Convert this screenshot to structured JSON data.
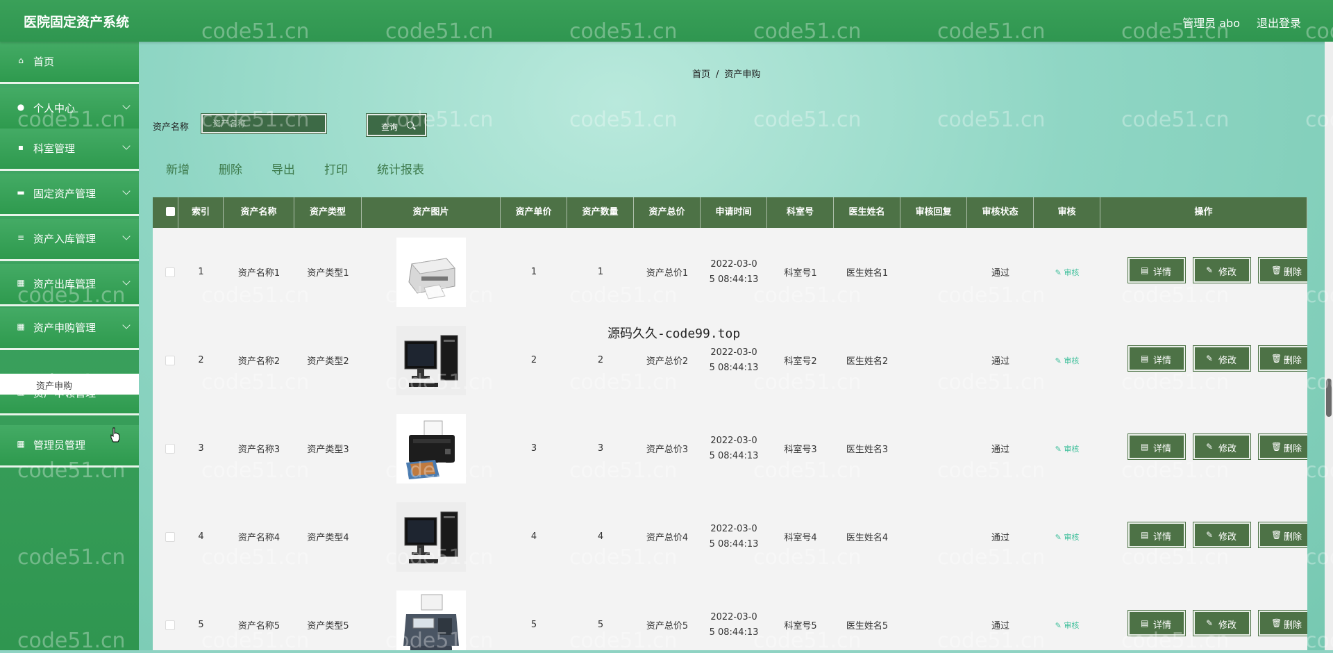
{
  "header": {
    "title": "医院固定资产系统",
    "user": "管理员 abo",
    "logout": "退出登录"
  },
  "sidebar": {
    "items": [
      {
        "label": "首页",
        "icon": "home-icon",
        "arrow": false
      },
      {
        "label": "个人中心",
        "icon": "user-icon",
        "arrow": true
      },
      {
        "label": "科室管理",
        "icon": "clipboard-icon",
        "arrow": true
      },
      {
        "label": "固定资产管理",
        "icon": "file-icon",
        "arrow": true
      },
      {
        "label": "资产入库管理",
        "icon": "list-icon",
        "arrow": true
      },
      {
        "label": "资产出库管理",
        "icon": "grid-icon",
        "arrow": true
      },
      {
        "label": "资产申购管理",
        "icon": "grid-icon",
        "arrow": true
      },
      {
        "label": "资产申领管理",
        "icon": "grid-icon",
        "arrow": true
      },
      {
        "label": "管理员管理",
        "icon": "grid-icon",
        "arrow": false
      }
    ],
    "submenu": {
      "label": "资产申购"
    }
  },
  "breadcrumb": {
    "home": "首页",
    "separator": "/",
    "current": "资产申购"
  },
  "search": {
    "label": "资产名称",
    "placeholder": "资产名称",
    "value": "",
    "button": "查询"
  },
  "actions": [
    "新增",
    "删除",
    "导出",
    "打印",
    "统计报表"
  ],
  "table": {
    "headers": [
      "索引",
      "资产名称",
      "资产类型",
      "资产图片",
      "资产单价",
      "资产数量",
      "资产总价",
      "申请时间",
      "科室号",
      "医生姓名",
      "审核回复",
      "审核状态",
      "审核",
      "操作"
    ],
    "audit_label": "审核",
    "buttons": {
      "detail": "详情",
      "edit": "修改",
      "delete": "删除"
    },
    "rows": [
      {
        "index": "1",
        "name": "资产名称1",
        "type": "资产类型1",
        "image": "printer-image",
        "price": "1",
        "qty": "1",
        "total": "资产总价1",
        "time1": "2022-03-0",
        "time2": "5 08:44:13",
        "dept": "科室号1",
        "doctor": "医生姓名1",
        "reply": "",
        "status": "通过"
      },
      {
        "index": "2",
        "name": "资产名称2",
        "type": "资产类型2",
        "image": "desktop-computer-image",
        "price": "2",
        "qty": "2",
        "total": "资产总价2",
        "time1": "2022-03-0",
        "time2": "5 08:44:13",
        "dept": "科室号2",
        "doctor": "医生姓名2",
        "reply": "",
        "status": "通过"
      },
      {
        "index": "3",
        "name": "资产名称3",
        "type": "资产类型3",
        "image": "inkjet-printer-image",
        "price": "3",
        "qty": "3",
        "total": "资产总价3",
        "time1": "2022-03-0",
        "time2": "5 08:44:13",
        "dept": "科室号3",
        "doctor": "医生姓名3",
        "reply": "",
        "status": "通过"
      },
      {
        "index": "4",
        "name": "资产名称4",
        "type": "资产类型4",
        "image": "desktop-computer-image",
        "price": "4",
        "qty": "4",
        "total": "资产总价4",
        "time1": "2022-03-0",
        "time2": "5 08:44:13",
        "dept": "科室号4",
        "doctor": "医生姓名4",
        "reply": "",
        "status": "通过"
      },
      {
        "index": "5",
        "name": "资产名称5",
        "type": "资产类型5",
        "image": "fax-machine-image",
        "price": "5",
        "qty": "5",
        "total": "资产总价5",
        "time1": "2022-03-0",
        "time2": "5 08:44:13",
        "dept": "科室号5",
        "doctor": "医生姓名5",
        "reply": "",
        "status": "通过"
      }
    ]
  },
  "watermark": {
    "text": "code51.cn",
    "overlay": "源码久久-code99.top"
  },
  "colors": {
    "primary": "#3aa059",
    "dark_green": "#4d7246",
    "link": "#3dbf9a"
  }
}
